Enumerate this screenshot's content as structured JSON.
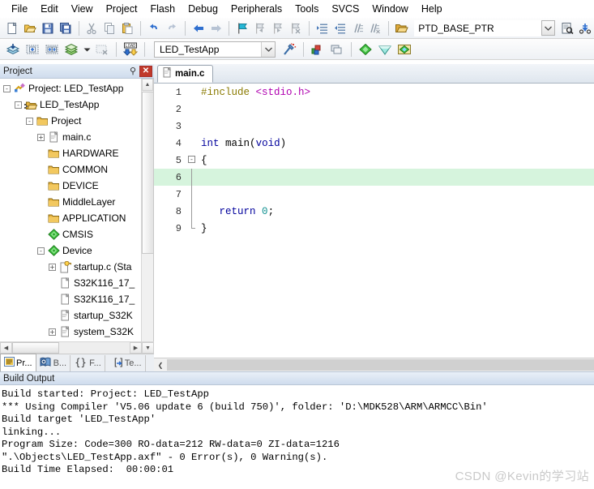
{
  "menubar": {
    "items": [
      {
        "label": "File"
      },
      {
        "label": "Edit"
      },
      {
        "label": "View"
      },
      {
        "label": "Project"
      },
      {
        "label": "Flash"
      },
      {
        "label": "Debug"
      },
      {
        "label": "Peripherals"
      },
      {
        "label": "Tools"
      },
      {
        "label": "SVCS"
      },
      {
        "label": "Window"
      },
      {
        "label": "Help"
      }
    ]
  },
  "toolbar1": {
    "icons": [
      "new-file-icon",
      "open-file-icon",
      "save-icon",
      "save-all-icon",
      "cut-icon",
      "copy-icon",
      "paste-icon",
      "undo-icon",
      "redo-icon",
      "navigate-back-icon",
      "navigate-forward-icon",
      "bookmark-toggle-icon",
      "bookmark-prev-icon",
      "bookmark-next-icon",
      "bookmark-clear-icon",
      "indent-icon",
      "outdent-icon",
      "comment-icon",
      "uncomment-icon",
      "open-folder-icon"
    ],
    "symbol_value": "PTD_BASE_PTR",
    "symbol_dropdown_icon": "chevron-down-icon",
    "find-in-files-icon": "find-in-files-icon",
    "binoculars-icon": "binoculars-icon"
  },
  "toolbar2": {
    "icons": [
      "translate-icon",
      "build-icon",
      "rebuild-icon",
      "batch-build-icon",
      "batch-build-dropdown-icon",
      "stop-build-icon",
      "download-icon"
    ],
    "target_label": "LED_TestApp",
    "target_dropdown_icon": "chevron-down-icon",
    "wand_icon": "target-options-icon",
    "manage_icon": "manage-project-items-icon",
    "multiproject_icon": "multi-project-icon",
    "pack_icons": [
      "pack-installer-icon",
      "manage-rte-icon",
      "pack-update-icon"
    ]
  },
  "project_panel": {
    "title": "Project",
    "pin_icon": "pin-icon",
    "close_icon": "close-icon",
    "tree": [
      {
        "indent": 0,
        "expander": "-",
        "icon": "project-icon",
        "label": "Project: LED_TestApp"
      },
      {
        "indent": 1,
        "expander": "-",
        "icon": "target-icon",
        "label": "LED_TestApp"
      },
      {
        "indent": 2,
        "expander": "-",
        "icon": "folder-icon",
        "label": "Project"
      },
      {
        "indent": 3,
        "expander": "+",
        "icon": "c-file-icon",
        "label": "main.c"
      },
      {
        "indent": 3,
        "expander": "",
        "icon": "folder-icon",
        "label": "HARDWARE"
      },
      {
        "indent": 3,
        "expander": "",
        "icon": "folder-icon",
        "label": "COMMON"
      },
      {
        "indent": 3,
        "expander": "",
        "icon": "folder-icon",
        "label": "DEVICE"
      },
      {
        "indent": 3,
        "expander": "",
        "icon": "folder-icon",
        "label": "MiddleLayer"
      },
      {
        "indent": 3,
        "expander": "",
        "icon": "folder-icon",
        "label": "APPLICATION"
      },
      {
        "indent": 3,
        "expander": "",
        "icon": "cmsis-icon",
        "label": "CMSIS"
      },
      {
        "indent": 3,
        "expander": "-",
        "icon": "cmsis-icon",
        "label": "Device"
      },
      {
        "indent": 4,
        "expander": "+",
        "icon": "key-file-icon",
        "label": "startup.c (Sta"
      },
      {
        "indent": 4,
        "expander": "",
        "icon": "file-icon",
        "label": "S32K116_17_"
      },
      {
        "indent": 4,
        "expander": "",
        "icon": "file-icon",
        "label": "S32K116_17_"
      },
      {
        "indent": 4,
        "expander": "",
        "icon": "c-file-icon",
        "label": "startup_S32K"
      },
      {
        "indent": 4,
        "expander": "+",
        "icon": "c-file-icon",
        "label": "system_S32K"
      }
    ],
    "tabs": [
      {
        "label": "Pr...",
        "icon": "project-tab-icon",
        "active": true
      },
      {
        "label": "B...",
        "icon": "books-tab-icon",
        "active": false
      },
      {
        "label": "F...",
        "icon": "functions-tab-icon",
        "active": false
      },
      {
        "label": "Te...",
        "icon": "templates-tab-icon",
        "active": false
      }
    ]
  },
  "editor": {
    "tab_label": "main.c",
    "tab_icon": "c-file-icon",
    "lines": [
      {
        "num": "1",
        "fold": "none",
        "highlight": false,
        "tokens": [
          {
            "t": "#include",
            "c": "k-pre"
          },
          {
            "t": " ",
            "c": "k-punc"
          },
          {
            "t": "<stdio.h>",
            "c": "k-inc"
          }
        ]
      },
      {
        "num": "2",
        "fold": "none",
        "highlight": false,
        "tokens": []
      },
      {
        "num": "3",
        "fold": "none",
        "highlight": false,
        "tokens": []
      },
      {
        "num": "4",
        "fold": "none",
        "highlight": false,
        "tokens": [
          {
            "t": "int",
            "c": "k-type"
          },
          {
            "t": " ",
            "c": "k-punc"
          },
          {
            "t": "main",
            "c": "k-id"
          },
          {
            "t": "(",
            "c": "k-punc"
          },
          {
            "t": "void",
            "c": "k-kw"
          },
          {
            "t": ")",
            "c": "k-punc"
          }
        ]
      },
      {
        "num": "5",
        "fold": "box",
        "highlight": false,
        "tokens": [
          {
            "t": "{",
            "c": "k-punc"
          }
        ]
      },
      {
        "num": "6",
        "fold": "line",
        "highlight": true,
        "tokens": []
      },
      {
        "num": "7",
        "fold": "line",
        "highlight": false,
        "tokens": []
      },
      {
        "num": "8",
        "fold": "line",
        "highlight": false,
        "tokens": [
          {
            "t": "   ",
            "c": "k-punc"
          },
          {
            "t": "return",
            "c": "k-kw"
          },
          {
            "t": " ",
            "c": "k-punc"
          },
          {
            "t": "0",
            "c": "k-num"
          },
          {
            "t": ";",
            "c": "k-punc"
          }
        ]
      },
      {
        "num": "9",
        "fold": "end",
        "highlight": false,
        "tokens": [
          {
            "t": "}",
            "c": "k-punc"
          }
        ]
      }
    ]
  },
  "build_output": {
    "title": "Build Output",
    "lines": [
      "Build started: Project: LED_TestApp",
      "*** Using Compiler 'V5.06 update 6 (build 750)', folder: 'D:\\MDK528\\ARM\\ARMCC\\Bin'",
      "Build target 'LED_TestApp'",
      "linking...",
      "Program Size: Code=300 RO-data=212 RW-data=0 ZI-data=1216",
      "\".\\Objects\\LED_TestApp.axf\" - 0 Error(s), 0 Warning(s).",
      "Build Time Elapsed:  00:00:01"
    ]
  },
  "watermark": {
    "text": "CSDN @Kevin的学习站"
  }
}
